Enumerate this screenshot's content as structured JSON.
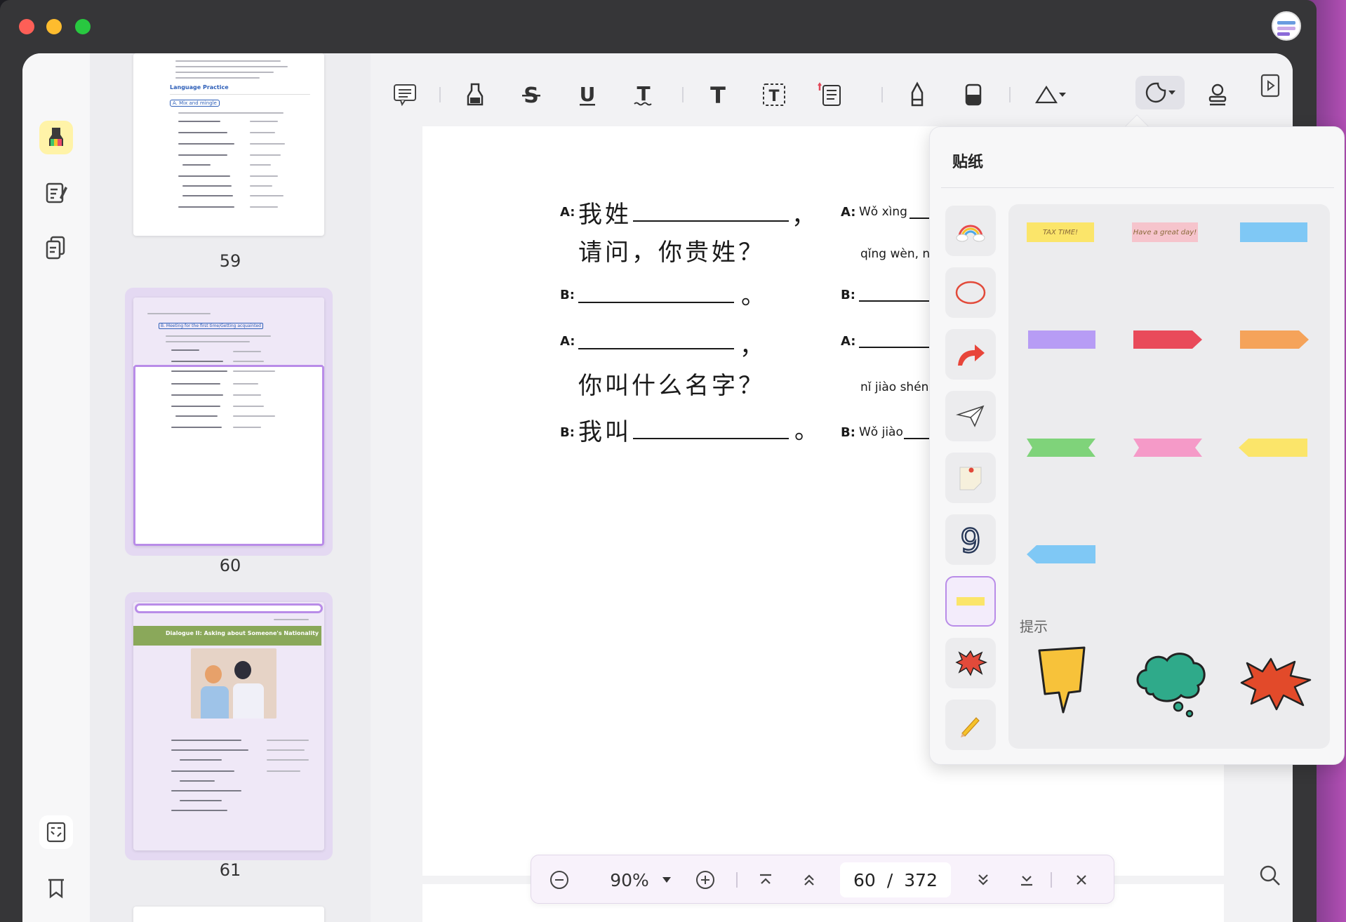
{
  "colors": {
    "accent": "#a06ef0",
    "highlight_bg": "#fff3a8",
    "selected_frame": "#b98ce8"
  },
  "thumbnails": [
    {
      "number": "59"
    },
    {
      "number": "60"
    },
    {
      "number": "61",
      "heading": "Dialogue II: Asking about Someone's Nationality"
    }
  ],
  "thumbnail_59": {
    "section": "Language Practice",
    "subsection": "A. Mix and mingle"
  },
  "thumbnail_60": {
    "subsection": "B. Meeting for the first time/Getting acquainted"
  },
  "document": {
    "rows": [
      {
        "label": "A:",
        "zh": "我姓",
        "end": "，"
      },
      {
        "label": "",
        "zh": "请问，你贵姓？",
        "end": ""
      },
      {
        "label": "B:",
        "zh": "",
        "end": "。"
      },
      {
        "label": "A:",
        "zh": "",
        "end": "，"
      },
      {
        "label": "",
        "zh": "你叫什么名字？",
        "end": ""
      },
      {
        "label": "B:",
        "zh": "我叫",
        "end": "。"
      }
    ],
    "pinyin": [
      {
        "label": "A:",
        "text": "Wǒ xìng"
      },
      {
        "label": "",
        "text": "qǐng wèn, nǐ guì"
      },
      {
        "label": "B:",
        "text": ""
      },
      {
        "label": "A:",
        "text": ""
      },
      {
        "label": "",
        "text": "nǐ jiào shénme m"
      },
      {
        "label": "B:",
        "text": "Wǒ jiào"
      }
    ]
  },
  "bottombar": {
    "zoom": "90%",
    "current_page": "60",
    "separator": "/",
    "total_pages": "372"
  },
  "sticker_popover": {
    "title": "贴纸",
    "tips_label": "提示",
    "tape_texts": [
      "TAX TIME!",
      "Have a great day!"
    ]
  }
}
